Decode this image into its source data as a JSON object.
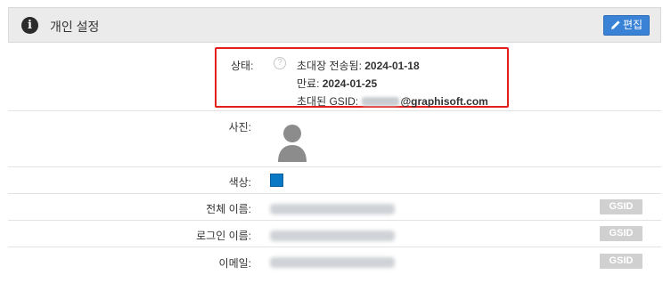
{
  "header": {
    "title": "개인 설정",
    "edit_label": "편집"
  },
  "status": {
    "label": "상태:",
    "help_glyph": "?",
    "invited_prefix": "초대장 전송됨: ",
    "invited_date": "2024-01-18",
    "expires_prefix": "만료: ",
    "expires_date": "2024-01-25",
    "gsid_prefix": "초대된 GSID: ",
    "gsid_domain": "@graphisoft.com"
  },
  "photo": {
    "label": "사진:"
  },
  "color": {
    "label": "색상:",
    "value": "#0a79c5"
  },
  "fields": [
    {
      "label": "전체 이름:",
      "badge": "GSID"
    },
    {
      "label": "로그인 이름:",
      "badge": "GSID"
    },
    {
      "label": "이메일:",
      "badge": "GSID"
    }
  ]
}
